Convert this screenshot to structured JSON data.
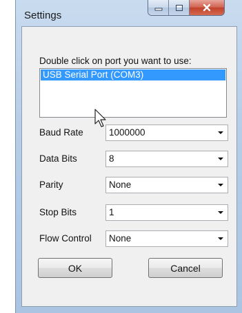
{
  "window": {
    "title": "Settings",
    "controls": [
      "minimize-icon",
      "maximize-icon",
      "close-icon"
    ]
  },
  "port_list": {
    "prompt": "Double click on port you want to use:",
    "items": [
      "USB Serial Port (COM3)"
    ],
    "selected_index": 0
  },
  "fields": [
    {
      "label": "Baud Rate",
      "value": "1000000"
    },
    {
      "label": "Data Bits",
      "value": "8"
    },
    {
      "label": "Parity",
      "value": "None"
    },
    {
      "label": "Stop Bits",
      "value": "1"
    },
    {
      "label": "Flow Control",
      "value": "None"
    }
  ],
  "buttons": {
    "ok": "OK",
    "cancel": "Cancel"
  },
  "colors": {
    "selection": "#3399ff",
    "close_button": "#c2402b",
    "frame": "#b7cde7"
  }
}
